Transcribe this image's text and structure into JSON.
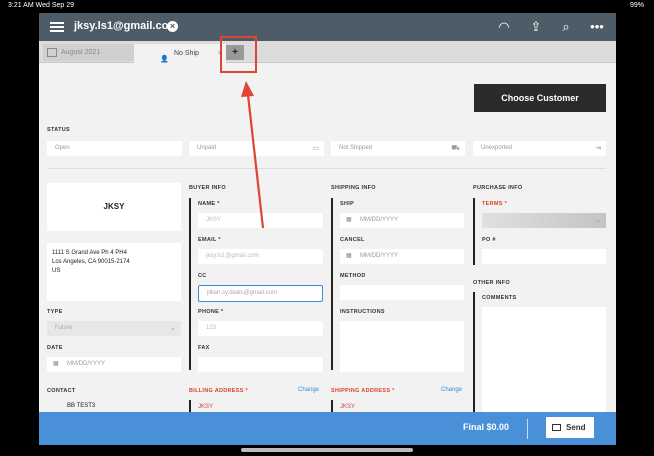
{
  "status_bar": {
    "time": "3:21 AM  Wed Sep 29",
    "battery": "99%"
  },
  "header": {
    "account": "jksy.ls1@gmail.com"
  },
  "tabs": [
    {
      "label": "August 2021"
    },
    {
      "label": "No Ship"
    },
    {
      "label": "+"
    }
  ],
  "actions": {
    "choose_customer": "Choose Customer"
  },
  "status": {
    "title": "STATUS",
    "fields": [
      "Open",
      "Unpaid",
      "Not Shipped",
      "Unexported"
    ]
  },
  "customer": {
    "name": "JKSY",
    "address_line1": "1111 S Grand Ave Ph 4 PH4",
    "address_line2": "Los Angeles, CA 90015-2174",
    "address_line3": "US",
    "type_label": "TYPE",
    "type_value": "Future",
    "date_label": "DATE",
    "date_placeholder": "MM/DD/YYYY",
    "contact_label": "CONTACT",
    "contact_value": "BB TEST3"
  },
  "buyer": {
    "title": "BUYER INFO",
    "name_label": "NAME *",
    "name_placeholder": "JKSY",
    "email_label": "EMAIL *",
    "email_placeholder": "jksy.ls1@gmail.com",
    "cc_label": "CC",
    "cc_value": "jillian.sy.deals@gmail.com",
    "phone_label": "PHONE *",
    "phone_placeholder": "123",
    "fax_label": "FAX",
    "billing_label": "BILLING ADDRESS *",
    "billing_change": "Change",
    "billing_value": "JKSY"
  },
  "shipping": {
    "title": "SHIPPING INFO",
    "ship_label": "SHIP",
    "ship_placeholder": "MM/DD/YYYY",
    "cancel_label": "CANCEL",
    "cancel_placeholder": "MM/DD/YYYY",
    "method_label": "METHOD",
    "instructions_label": "INSTRUCTIONS",
    "address_label": "SHIPPING ADDRESS *",
    "address_change": "Change",
    "address_value": "JKSY"
  },
  "purchase": {
    "title": "PURCHASE INFO",
    "terms_label": "TERMS *",
    "po_label": "PO #",
    "other_title": "OTHER INFO",
    "comments_label": "COMMENTS"
  },
  "footer": {
    "total": "Final $0.00",
    "send": "Send"
  },
  "colors": {
    "header": "#4d5c66",
    "footer": "#4a90d9",
    "accent_red": "#e24333"
  }
}
